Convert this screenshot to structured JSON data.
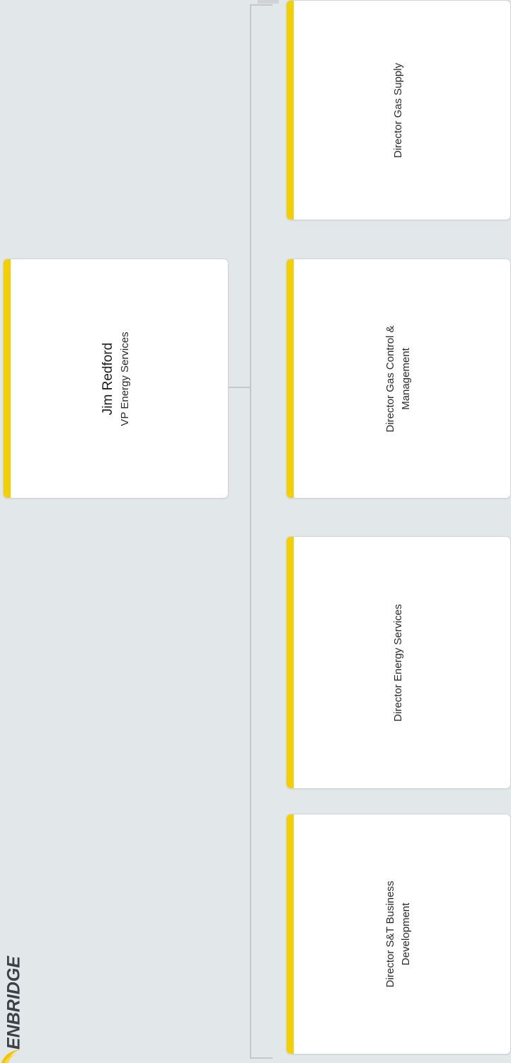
{
  "brand": {
    "logo_text": "ENBRIDGE",
    "accent_color": "#f5d000",
    "background_color": "#e2e8ea"
  },
  "org_chart": {
    "root": {
      "name": "Jim Redford",
      "title": "VP Energy Services"
    },
    "children": [
      {
        "title": "Director Gas Supply"
      },
      {
        "title": "Director Gas Control & Management"
      },
      {
        "title": "Director Energy Services"
      },
      {
        "title": "Director S&T Business Development"
      }
    ]
  }
}
